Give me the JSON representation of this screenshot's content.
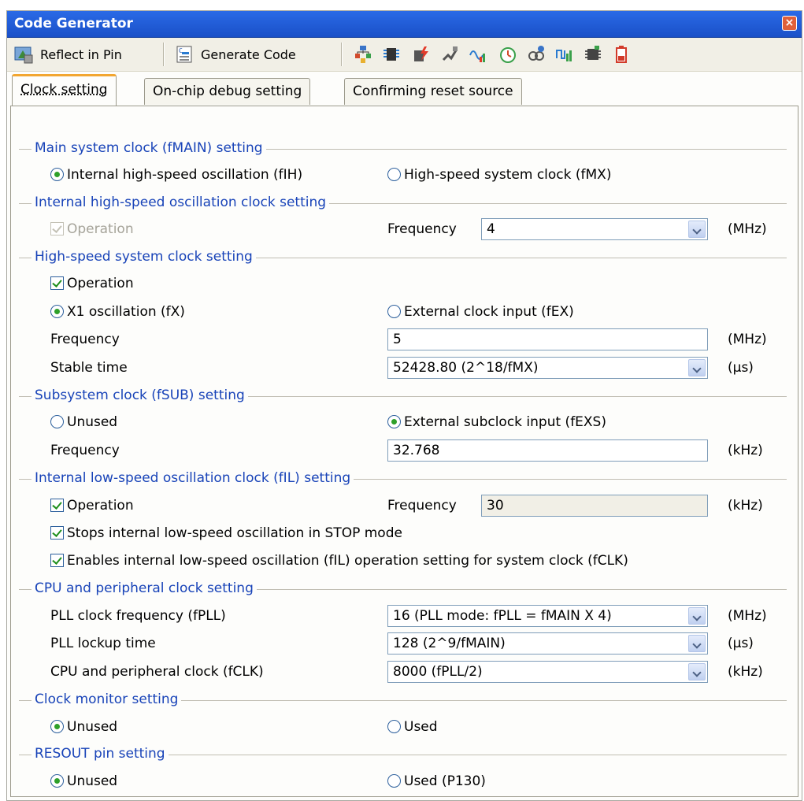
{
  "window": {
    "title": "Code Generator"
  },
  "toolbar": {
    "reflect_label": "Reflect in Pin",
    "generate_label": "Generate Code",
    "icons": [
      "pin-config-icon",
      "port-icon",
      "interrupt-icon",
      "serial-icon",
      "adc-icon",
      "timer-icon",
      "watchdog-icon",
      "pwm-icon",
      "dma-icon",
      "battery-icon"
    ]
  },
  "tabs": [
    {
      "label": "Clock setting",
      "active": true
    },
    {
      "label": "On-chip debug setting",
      "active": false
    },
    {
      "label": "Confirming reset source",
      "active": false
    }
  ],
  "main_clock": {
    "group": "Main system clock (fMAIN) setting",
    "opt_internal": "Internal high-speed oscillation (fIH)",
    "opt_highspeed": "High-speed system clock (fMX)",
    "selected": "internal"
  },
  "internal_hs": {
    "group": "Internal high-speed oscillation clock setting",
    "operation": "Operation",
    "frequency_label": "Frequency",
    "frequency_value": "4",
    "unit": "(MHz)"
  },
  "highspeed": {
    "group": "High-speed system clock setting",
    "operation": "Operation",
    "opt_x1": "X1 oscillation (fX)",
    "opt_ext": "External clock input (fEX)",
    "frequency_label": "Frequency",
    "frequency_value": "5",
    "frequency_unit": "(MHz)",
    "stable_label": "Stable time",
    "stable_value": "52428.80 (2^18/fMX)",
    "stable_unit": "(µs)"
  },
  "subsystem": {
    "group": "Subsystem clock (fSUB) setting",
    "opt_unused": "Unused",
    "opt_ext": "External subclock input (fEXS)",
    "frequency_label": "Frequency",
    "frequency_value": "32.768",
    "unit": "(kHz)"
  },
  "internal_ls": {
    "group": "Internal low-speed oscillation clock (fIL) setting",
    "operation": "Operation",
    "frequency_label": "Frequency",
    "frequency_value": "30",
    "unit": "(kHz)",
    "stop_mode": "Stops internal low-speed oscillation in STOP mode",
    "enables": "Enables internal low-speed oscillation (fIL) operation setting for system clock (fCLK)"
  },
  "cpu": {
    "group": "CPU and peripheral clock setting",
    "pll_freq_label": "PLL clock frequency (fPLL)",
    "pll_freq_value": "16 (PLL mode: fPLL = fMAIN X 4)",
    "pll_freq_unit": "(MHz)",
    "pll_lock_label": "PLL lockup time",
    "pll_lock_value": "128 (2^9/fMAIN)",
    "pll_lock_unit": "(µs)",
    "fclk_label": "CPU and peripheral clock (fCLK)",
    "fclk_value": "8000 (fPLL/2)",
    "fclk_unit": "(kHz)"
  },
  "monitor": {
    "group": "Clock monitor setting",
    "opt_unused": "Unused",
    "opt_used": "Used"
  },
  "resout": {
    "group": "RESOUT pin setting",
    "opt_unused": "Unused",
    "opt_used": "Used (P130)"
  }
}
